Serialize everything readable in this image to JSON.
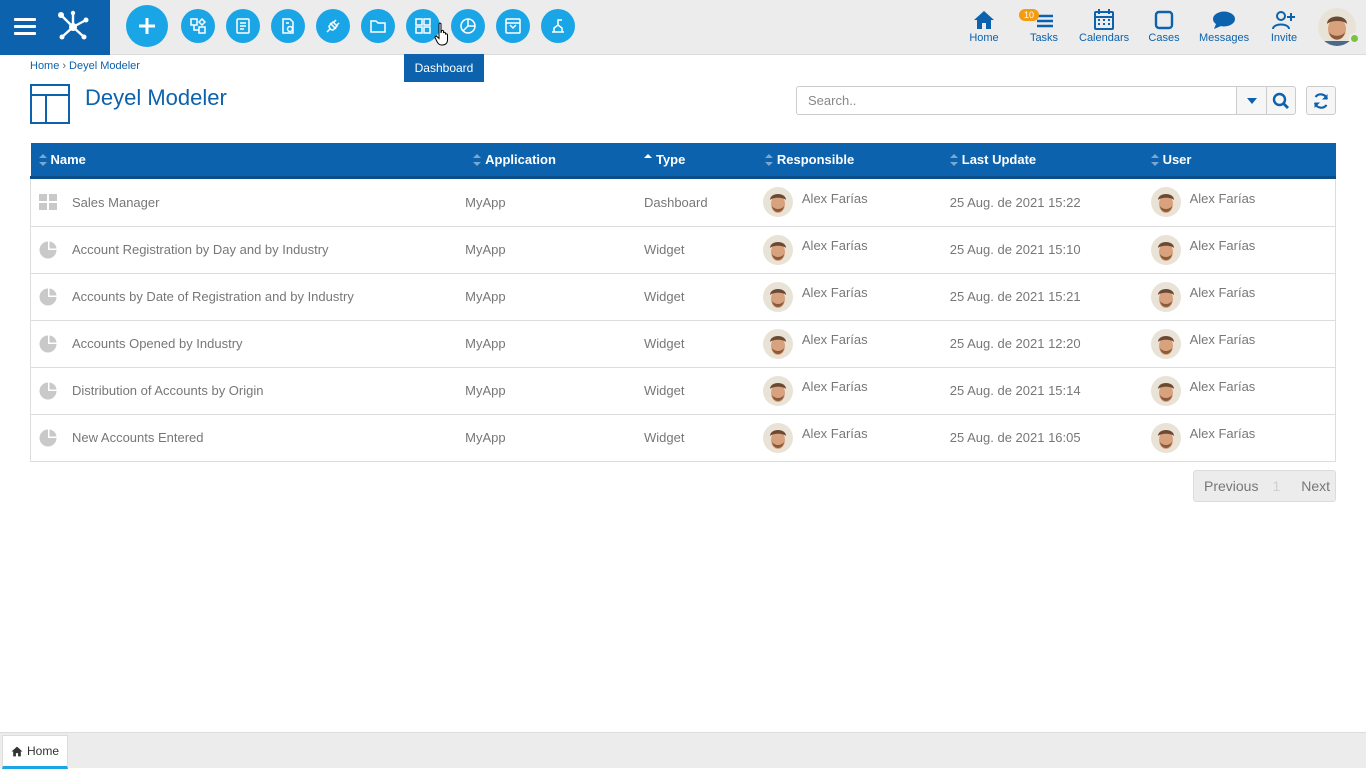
{
  "toolbar": {
    "tools": [
      "add-icon",
      "process-modeler-icon",
      "forms-icon",
      "rules-icon",
      "integration-icon",
      "folder-icon",
      "dashboard-icon",
      "widget-icon",
      "archive-icon",
      "report-icon"
    ],
    "tooltip": "Dashboard"
  },
  "nav": {
    "home": "Home",
    "tasks": "Tasks",
    "tasks_badge": "10",
    "calendars": "Calendars",
    "cases": "Cases",
    "messages": "Messages",
    "invite": "Invite"
  },
  "breadcrumb": {
    "home": "Home",
    "separator": "›",
    "current": "Deyel Modeler"
  },
  "page": {
    "title": "Deyel Modeler"
  },
  "search": {
    "placeholder": "Search.."
  },
  "table": {
    "columns": [
      "Name",
      "Application",
      "Type",
      "Responsible",
      "Last Update",
      "User"
    ],
    "sorted_column": "Type",
    "rows": [
      {
        "icon": "dashboard-grid-icon",
        "name": "Sales Manager",
        "application": "MyApp",
        "type": "Dashboard",
        "responsible": "Alex Farías",
        "last_update": "25 Aug. de 2021 15:22",
        "user": "Alex Farías"
      },
      {
        "icon": "pie-chart-icon",
        "name": "Account Registration by Day and by Industry",
        "application": "MyApp",
        "type": "Widget",
        "responsible": "Alex Farías",
        "last_update": "25 Aug. de 2021 15:10",
        "user": "Alex Farías"
      },
      {
        "icon": "pie-chart-icon",
        "name": "Accounts by Date of Registration and by Industry",
        "application": "MyApp",
        "type": "Widget",
        "responsible": "Alex Farías",
        "last_update": "25 Aug. de 2021 15:21",
        "user": "Alex Farías"
      },
      {
        "icon": "pie-chart-icon",
        "name": "Accounts Opened by Industry",
        "application": "MyApp",
        "type": "Widget",
        "responsible": "Alex Farías",
        "last_update": "25 Aug. de 2021 12:20",
        "user": "Alex Farías"
      },
      {
        "icon": "pie-chart-icon",
        "name": "Distribution of Accounts by Origin",
        "application": "MyApp",
        "type": "Widget",
        "responsible": "Alex Farías",
        "last_update": "25 Aug. de 2021 15:14",
        "user": "Alex Farías"
      },
      {
        "icon": "pie-chart-icon",
        "name": "New Accounts Entered",
        "application": "MyApp",
        "type": "Widget",
        "responsible": "Alex Farías",
        "last_update": "25 Aug. de 2021 16:05",
        "user": "Alex Farías"
      }
    ]
  },
  "pager": {
    "previous": "Previous",
    "page": "1",
    "next": "Next"
  },
  "bottom_tabs": [
    {
      "label": "Home"
    }
  ],
  "colors": {
    "primary": "#0c62ad",
    "accent": "#1aa5e6",
    "badge": "#f39c12",
    "online": "#7cc242"
  }
}
